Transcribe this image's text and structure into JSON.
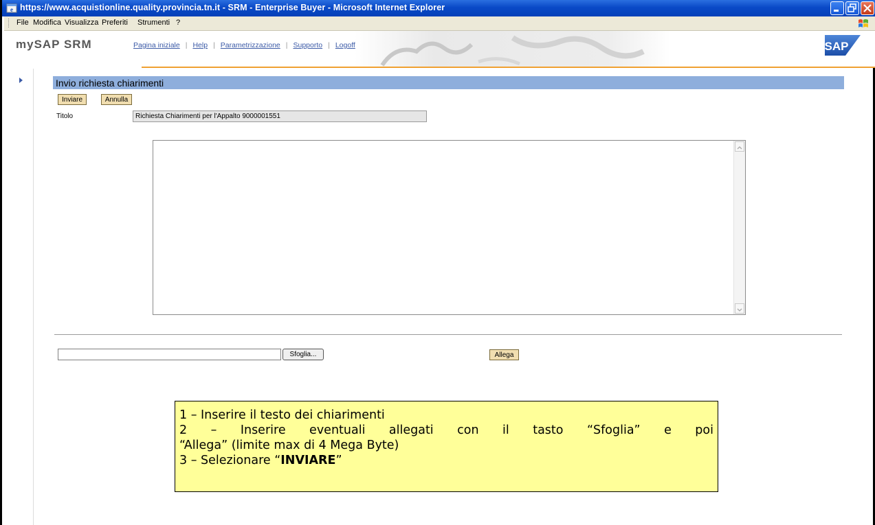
{
  "window": {
    "title": "https://www.acquistionline.quality.provincia.tn.it - SRM - Enterprise Buyer - Microsoft Internet Explorer"
  },
  "menu": {
    "items": [
      "File",
      "Modifica",
      "Visualizza",
      "Preferiti",
      "Strumenti",
      "?"
    ]
  },
  "sap": {
    "brand": "mySAP SRM",
    "nav": [
      "Pagina iniziale",
      "Help",
      "Parametrizzazione",
      "Supporto",
      "Logoff"
    ],
    "logo_text": "SAP"
  },
  "page": {
    "title": "Invio richiesta chiarimenti",
    "send_button": "Inviare",
    "cancel_button": "Annulla",
    "title_label": "Titolo",
    "title_value": "Richiesta Chiarimenti per l'Appalto 9000001551",
    "browse_button": "Sfoglia...",
    "attach_button": "Allega"
  },
  "note": {
    "line1": "1 – Inserire il testo dei chiarimenti",
    "line2": "2 – Inserire eventuali allegati con il tasto “Sfoglia” e poi",
    "line3": "“Allega” (limite max di 4 Mega Byte)",
    "line4_prefix": "3 – Selezionare “",
    "line4_bold": "INVIARE",
    "line4_suffix": "”"
  },
  "colors": {
    "titlebar": "#0a49c7",
    "page_title_bg": "#8eaedc",
    "button_bg": "#f1deb0",
    "note_bg": "#ffff99",
    "accent_line": "#f0a030"
  }
}
